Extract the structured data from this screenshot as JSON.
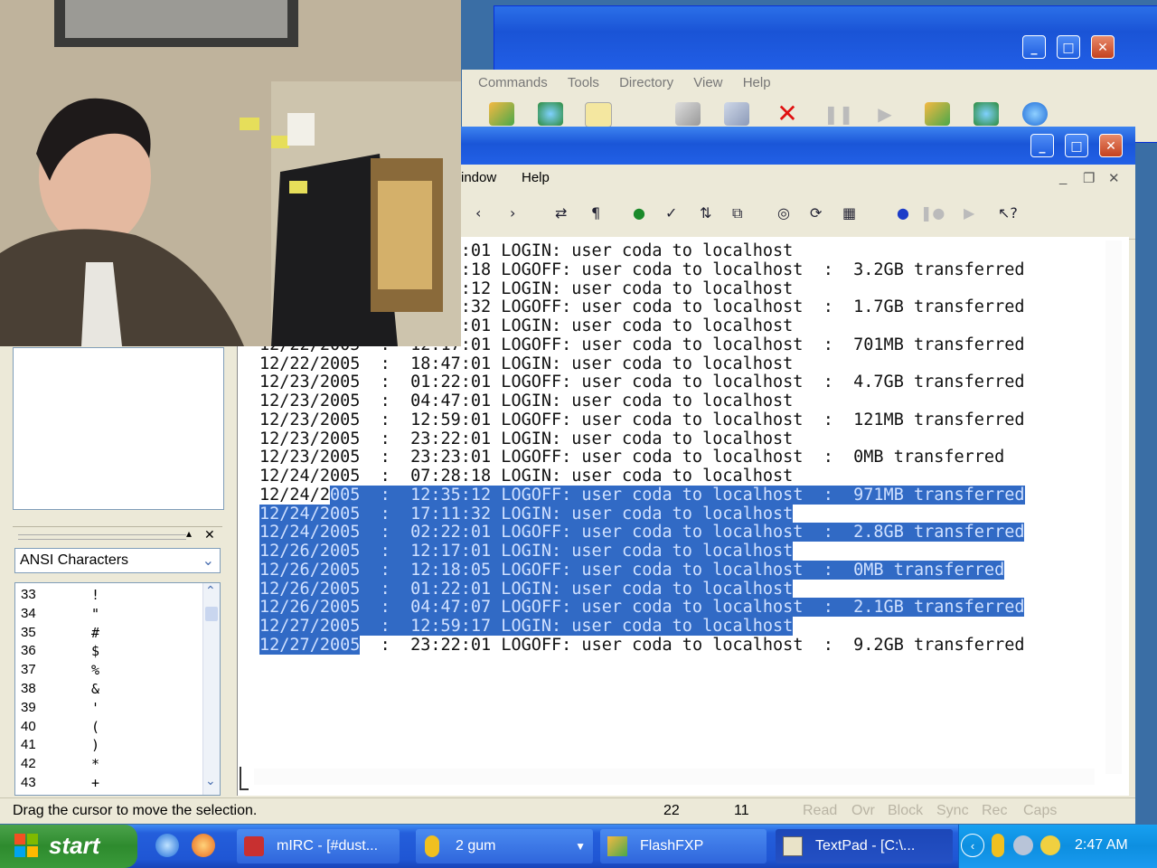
{
  "ftp_window": {
    "menu": [
      "Commands",
      "Tools",
      "Directory",
      "View",
      "Help"
    ]
  },
  "textpad": {
    "menu": [
      "Window",
      "Help"
    ],
    "menu_display": [
      "indow",
      "Help"
    ],
    "editor_lines": [
      {
        "date": "",
        "time": "2:01",
        "text": "LOGIN: user coda to localhost",
        "transfer": "",
        "hl": false
      },
      {
        "date": "",
        "time": "3:18",
        "text": "LOGOFF: user coda to localhost",
        "transfer": "3.2GB transferred",
        "hl": false
      },
      {
        "date": "",
        "time": "5:12",
        "text": "LOGIN: user coda to localhost",
        "transfer": "",
        "hl": false
      },
      {
        "date": "",
        "time": "1:32",
        "text": "LOGOFF: user coda to localhost",
        "transfer": "1.7GB transferred",
        "hl": false
      },
      {
        "date": "",
        "time": "1:01",
        "text": "LOGIN: user coda to localhost",
        "transfer": "",
        "hl": false
      },
      {
        "date": "12/22/2005",
        "time": "12:17:01",
        "text": "LOGOFF: user coda to localhost",
        "transfer": "701MB transferred",
        "hl": false
      },
      {
        "date": "12/22/2005",
        "time": "18:47:01",
        "text": "LOGIN: user coda to localhost",
        "transfer": "",
        "hl": false
      },
      {
        "date": "12/23/2005",
        "time": "01:22:01",
        "text": "LOGOFF: user coda to localhost",
        "transfer": "4.7GB transferred",
        "hl": false
      },
      {
        "date": "12/23/2005",
        "time": "04:47:01",
        "text": "LOGIN: user coda to localhost",
        "transfer": "",
        "hl": false
      },
      {
        "date": "12/23/2005",
        "time": "12:59:01",
        "text": "LOGOFF: user coda to localhost",
        "transfer": "121MB transferred",
        "hl": false
      },
      {
        "date": "12/23/2005",
        "time": "23:22:01",
        "text": "LOGIN: user coda to localhost",
        "transfer": "",
        "hl": false
      },
      {
        "date": "12/23/2005",
        "time": "23:23:01",
        "text": "LOGOFF: user coda to localhost",
        "transfer": "0MB transferred",
        "hl": false
      },
      {
        "date": "12/24/2005",
        "time": "07:28:18",
        "text": "LOGIN: user coda to localhost",
        "transfer": "",
        "hl": false
      },
      {
        "date": "12/24/2005",
        "time": "12:35:12",
        "text": "LOGOFF: user coda to localhost",
        "transfer": "971MB transferred",
        "hl": "partial"
      },
      {
        "date": "12/24/2005",
        "time": "17:11:32",
        "text": "LOGIN: user coda to localhost",
        "transfer": "",
        "hl": true
      },
      {
        "date": "12/24/2005",
        "time": "02:22:01",
        "text": "LOGOFF: user coda to localhost",
        "transfer": "2.8GB transferred",
        "hl": true
      },
      {
        "date": "12/26/2005",
        "time": "12:17:01",
        "text": "LOGIN: user coda to localhost",
        "transfer": "",
        "hl": true
      },
      {
        "date": "12/26/2005",
        "time": "12:18:05",
        "text": "LOGOFF: user coda to localhost",
        "transfer": "0MB transferred",
        "hl": true
      },
      {
        "date": "12/26/2005",
        "time": "01:22:01",
        "text": "LOGIN: user coda to localhost",
        "transfer": "",
        "hl": true
      },
      {
        "date": "12/26/2005",
        "time": "04:47:07",
        "text": "LOGOFF: user coda to localhost",
        "transfer": "2.1GB transferred",
        "hl": true
      },
      {
        "date": "12/27/2005",
        "time": "12:59:17",
        "text": "LOGIN: user coda to localhost",
        "transfer": "",
        "hl": true
      },
      {
        "date": "12/27/2005",
        "time": "23:22:01",
        "text": "LOGOFF: user coda to localhost",
        "transfer": "9.2GB transferred",
        "hl": "date"
      }
    ],
    "clip_library": {
      "selected": "ANSI Characters",
      "rows": [
        {
          "n": "33",
          "c": "!"
        },
        {
          "n": "34",
          "c": "\""
        },
        {
          "n": "35",
          "c": "#"
        },
        {
          "n": "36",
          "c": "$"
        },
        {
          "n": "37",
          "c": "%"
        },
        {
          "n": "38",
          "c": "&"
        },
        {
          "n": "39",
          "c": "'"
        },
        {
          "n": "40",
          "c": "("
        },
        {
          "n": "41",
          "c": ")"
        },
        {
          "n": "42",
          "c": "*"
        },
        {
          "n": "43",
          "c": "+"
        }
      ]
    },
    "status": {
      "message": "Drag the cursor to move the selection.",
      "line": "22",
      "col": "11",
      "flags": [
        "Read",
        "Ovr",
        "Block",
        "Sync",
        "Rec",
        "Caps"
      ]
    }
  },
  "taskbar": {
    "start_label": "start",
    "tasks": [
      {
        "label": "mIRC - [#dust...",
        "icon": "mirc-icon"
      },
      {
        "label": "2 gum",
        "icon": "messenger-icon"
      },
      {
        "label": "FlashFXP",
        "icon": "flashfxp-icon"
      },
      {
        "label": "TextPad - [C:\\...",
        "icon": "textpad-icon"
      }
    ],
    "clock": "2:47 AM"
  },
  "colors": {
    "selection": "#316ac5",
    "taskbar": "#245edb",
    "start_green": "#3a9a3a"
  }
}
